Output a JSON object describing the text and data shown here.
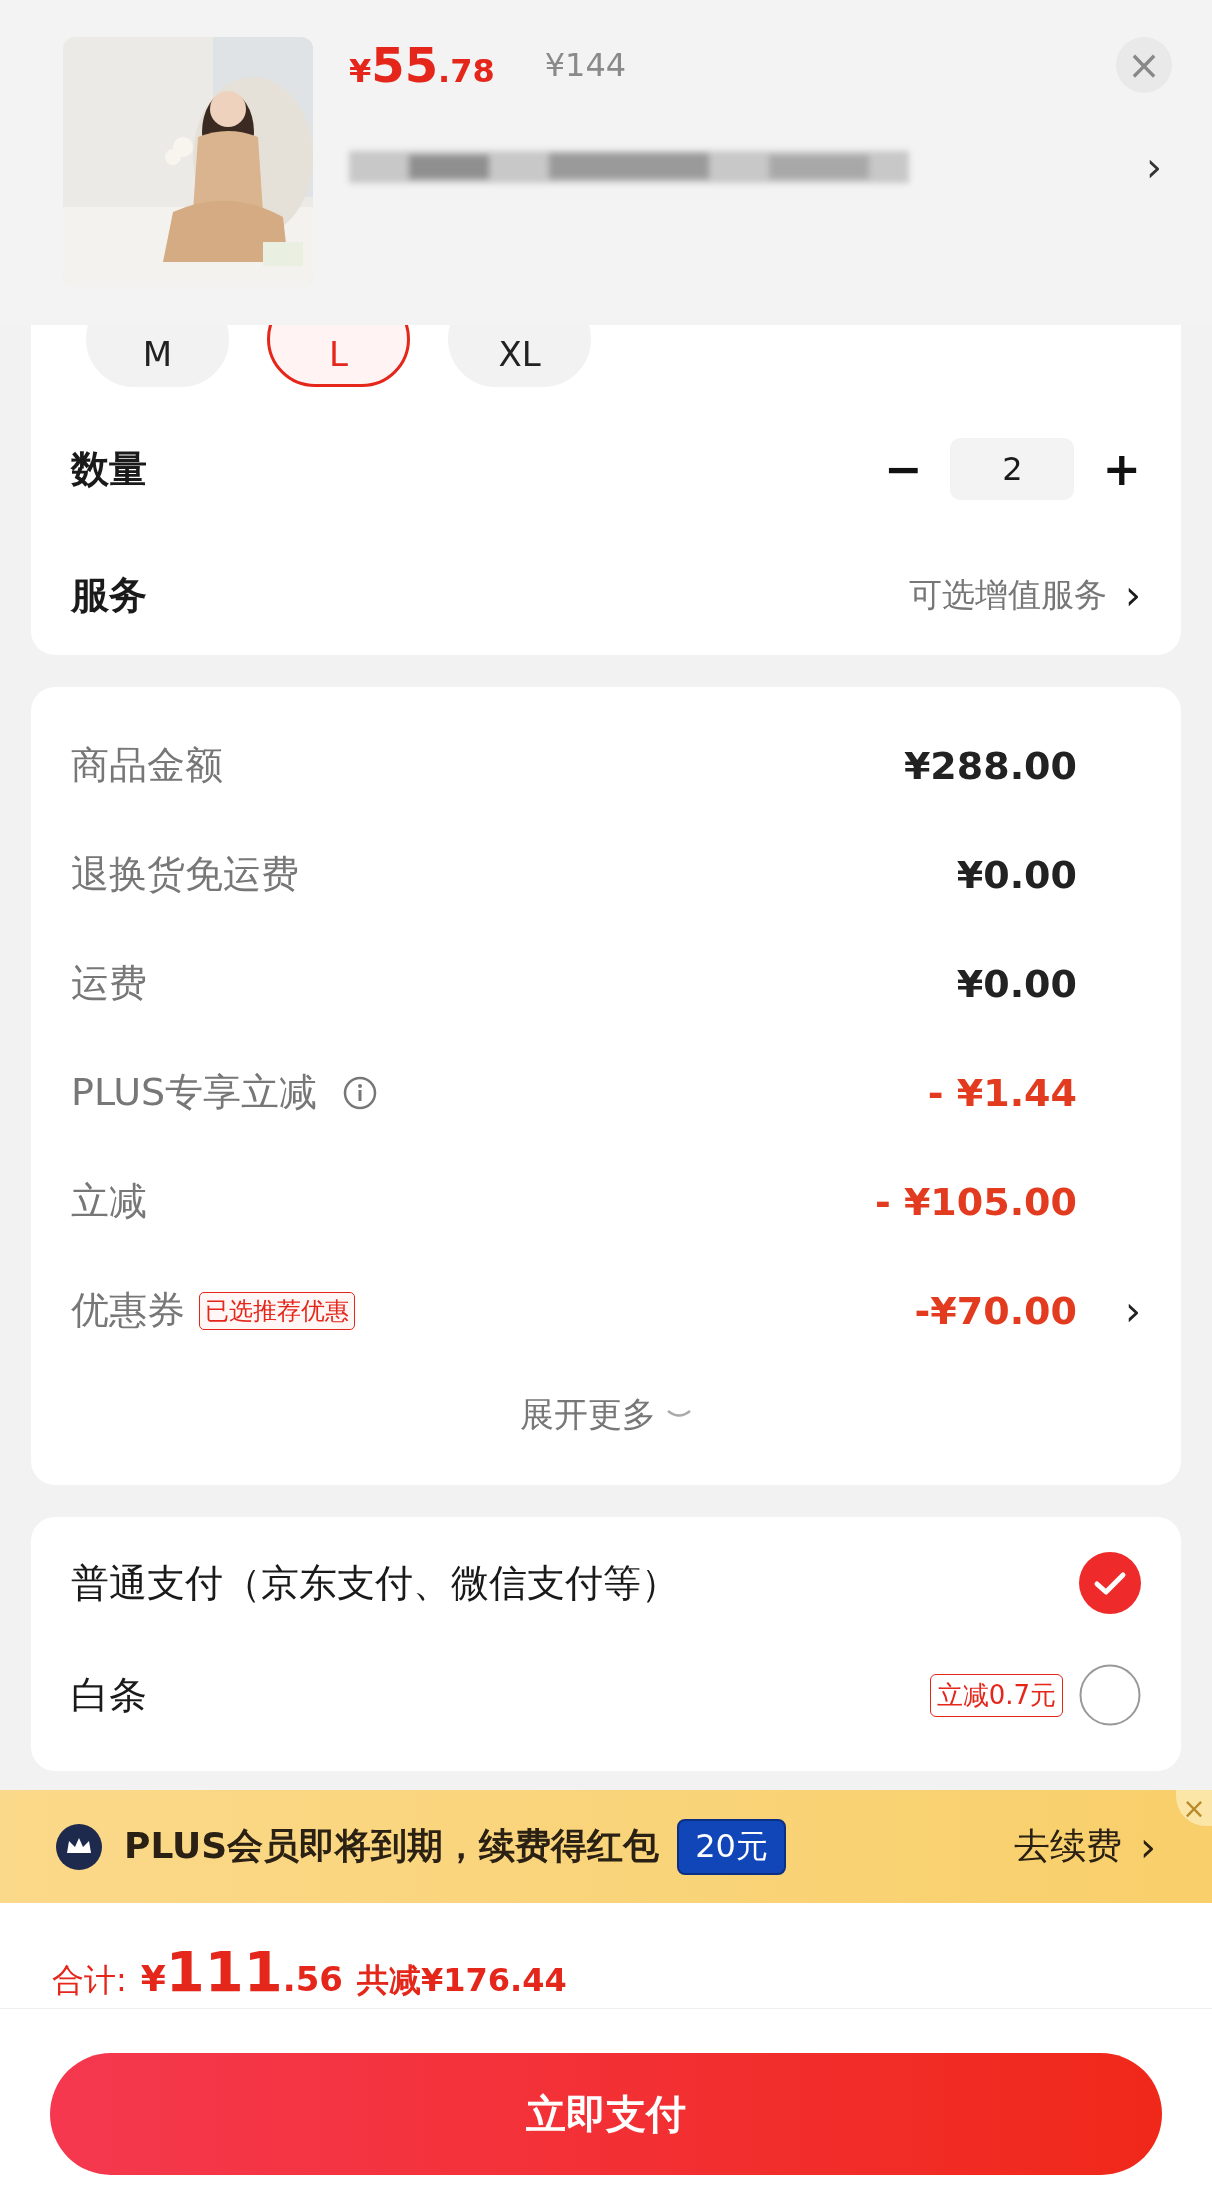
{
  "product": {
    "price_symbol": "¥",
    "price_main": "55",
    "price_decimal": ".78",
    "original_price": "¥144",
    "close": "×",
    "address_arrow": "›"
  },
  "sizes": [
    {
      "label": "M",
      "selected": false
    },
    {
      "label": "L",
      "selected": true
    },
    {
      "label": "XL",
      "selected": false
    }
  ],
  "quantity": {
    "label": "数量",
    "minus": "−",
    "value": "2",
    "plus": "+"
  },
  "service": {
    "label": "服务",
    "value": "可选增值服务",
    "arrow": "›"
  },
  "amounts": [
    {
      "label": "商品金额",
      "value": "¥288.00",
      "discount": false
    },
    {
      "label": "退换货免运费",
      "value": "¥0.00",
      "discount": false
    },
    {
      "label": "运费",
      "value": "¥0.00",
      "discount": false
    },
    {
      "label": "PLUS专享立减",
      "value": "- ¥1.44",
      "discount": true,
      "info": true
    },
    {
      "label": "立减",
      "value": "- ¥105.00",
      "discount": true
    },
    {
      "label": "优惠券",
      "tag": "已选推荐优惠",
      "value": "-¥70.00",
      "discount": true,
      "arrow": "›"
    }
  ],
  "expand": "展开更多",
  "payments": [
    {
      "label": "普通支付（京东支付、微信支付等）",
      "checked": true
    },
    {
      "label": "白条",
      "tag": "立减0.7元",
      "checked": false
    }
  ],
  "banner": {
    "text": "PLUS会员即将到期，续费得红包",
    "badge": "20元",
    "action": "去续费",
    "arrow": "›",
    "close": "×"
  },
  "total": {
    "label": "合计:",
    "symbol": "¥",
    "main": "111",
    "decimal": ".56",
    "saved": "共减¥176.44"
  },
  "pay_button": "立即支付"
}
